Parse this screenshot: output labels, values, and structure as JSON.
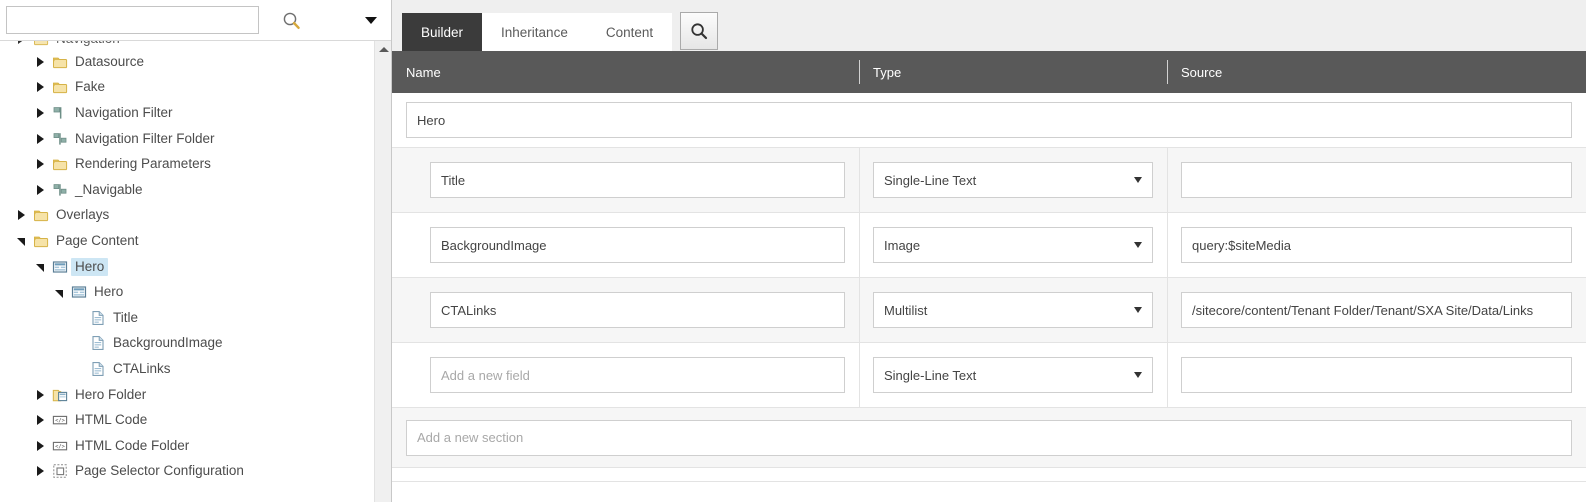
{
  "sidebar": {
    "search": {
      "value": "",
      "placeholder": ""
    },
    "search_icon": "search-icon",
    "dropdown_icon": "chevron-down-icon",
    "scroll_up_icon": "scroll-up-arrow-icon",
    "tree": [
      {
        "label": "Navigation",
        "icon": "folder-icon",
        "indent": 1,
        "toggle": "collapsed",
        "clipped": true,
        "selected": false
      },
      {
        "label": "Datasource",
        "icon": "folder-icon",
        "indent": 2,
        "toggle": "collapsed",
        "selected": false
      },
      {
        "label": "Fake",
        "icon": "folder-icon",
        "indent": 2,
        "toggle": "collapsed",
        "selected": false
      },
      {
        "label": "Navigation Filter",
        "icon": "template-field-icon",
        "indent": 2,
        "toggle": "collapsed",
        "selected": false
      },
      {
        "label": "Navigation Filter Folder",
        "icon": "template-folder-icon",
        "indent": 2,
        "toggle": "collapsed",
        "selected": false
      },
      {
        "label": "Rendering Parameters",
        "icon": "folder-icon",
        "indent": 2,
        "toggle": "collapsed",
        "selected": false
      },
      {
        "label": "_Navigable",
        "icon": "template-folder-icon",
        "indent": 2,
        "toggle": "collapsed",
        "selected": false
      },
      {
        "label": "Overlays",
        "icon": "folder-icon",
        "indent": 1,
        "toggle": "collapsed",
        "selected": false
      },
      {
        "label": "Page Content",
        "icon": "folder-icon",
        "indent": 1,
        "toggle": "expanded",
        "selected": false
      },
      {
        "label": "Hero",
        "icon": "template-icon",
        "indent": 2,
        "toggle": "expanded",
        "selected": true
      },
      {
        "label": "Hero",
        "icon": "template-icon",
        "indent": 3,
        "toggle": "expanded",
        "selected": false
      },
      {
        "label": "Title",
        "icon": "field-icon",
        "indent": 4,
        "toggle": "none",
        "selected": false
      },
      {
        "label": "BackgroundImage",
        "icon": "field-icon",
        "indent": 4,
        "toggle": "none",
        "selected": false
      },
      {
        "label": "CTALinks",
        "icon": "field-icon",
        "indent": 4,
        "toggle": "none",
        "selected": false
      },
      {
        "label": "Hero Folder",
        "icon": "template-folder-yellow-icon",
        "indent": 2,
        "toggle": "collapsed",
        "selected": false
      },
      {
        "label": "HTML Code",
        "icon": "html-code-icon",
        "indent": 2,
        "toggle": "collapsed",
        "selected": false
      },
      {
        "label": "HTML Code Folder",
        "icon": "html-code-folder-icon",
        "indent": 2,
        "toggle": "collapsed",
        "selected": false
      },
      {
        "label": "Page Selector Configuration",
        "icon": "page-selector-icon",
        "indent": 2,
        "toggle": "collapsed",
        "selected": false
      }
    ]
  },
  "main": {
    "tabs": [
      {
        "label": "Builder",
        "active": true
      },
      {
        "label": "Inheritance",
        "active": false
      },
      {
        "label": "Content",
        "active": false
      }
    ],
    "tab_search_icon": "search-icon",
    "columns": {
      "name": "Name",
      "type": "Type",
      "source": "Source"
    },
    "section": {
      "name_value": "Hero"
    },
    "fields": [
      {
        "name_value": "Title",
        "name_placeholder": "",
        "type_value": "Single-Line Text",
        "source_value": "",
        "alt": true
      },
      {
        "name_value": "BackgroundImage",
        "name_placeholder": "",
        "type_value": "Image",
        "source_value": "query:$siteMedia",
        "alt": false
      },
      {
        "name_value": "CTALinks",
        "name_placeholder": "",
        "type_value": "Multilist",
        "source_value": "/sitecore/content/Tenant Folder/Tenant/SXA Site/Data/Links",
        "alt": true
      },
      {
        "name_value": "",
        "name_placeholder": "Add a new field",
        "type_value": "Single-Line Text",
        "source_value": "",
        "alt": false
      }
    ],
    "add_section": {
      "placeholder": "Add a new section",
      "value": ""
    }
  },
  "colors": {
    "header_dark": "#595959",
    "tab_active": "#3b3b3b",
    "selection_blue": "#cde6f4",
    "panel_bg": "#efefef",
    "row_alt": "#f6f6f6",
    "folder_yellow": "#e8c55a",
    "template_teal": "#7f9f99"
  }
}
